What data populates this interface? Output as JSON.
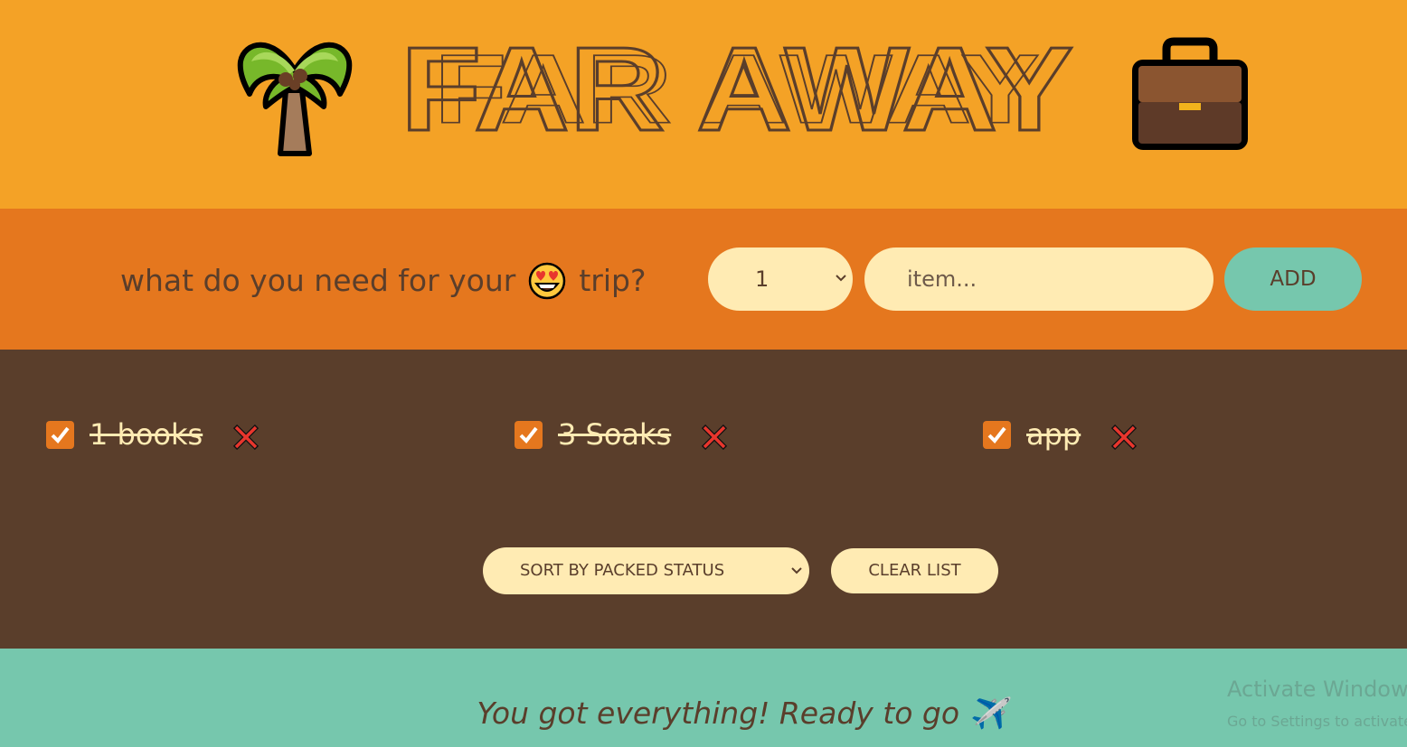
{
  "header": {
    "title": "FAR AWAY",
    "left_icon": "palm-tree-icon",
    "right_icon": "briefcase-icon"
  },
  "form": {
    "question_before": "what do you need for your",
    "question_emoji": "smiling-face-with-heart-eyes-icon",
    "question_after": "trip?",
    "quantity_value": "1",
    "item_placeholder": "item...",
    "add_label": "ADD"
  },
  "items": [
    {
      "label": "1 books",
      "packed": true
    },
    {
      "label": "3 Soaks",
      "packed": true
    },
    {
      "label": "app",
      "packed": true
    }
  ],
  "actions": {
    "sort_value": "SORT BY PACKED STATUS",
    "clear_label": "CLEAR LIST"
  },
  "stats": {
    "message": "You got everything! Ready to go ✈️"
  },
  "watermark": {
    "line1": "Activate Windows",
    "line2": "Go to Settings to activate Windows."
  },
  "colors": {
    "header_bg": "#f4a226",
    "form_bg": "#e5771e",
    "list_bg": "#5a3e2b",
    "stats_bg": "#76c7ad",
    "input_bg": "#ffebb3",
    "text_dark": "#5a3e2b"
  }
}
